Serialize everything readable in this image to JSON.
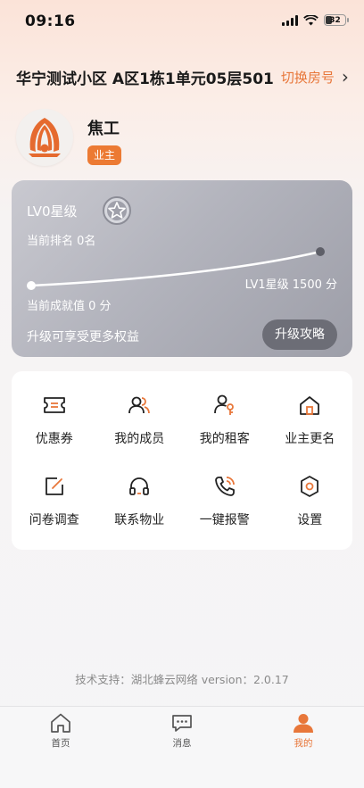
{
  "status_bar": {
    "time": "09:16",
    "battery": "32"
  },
  "header": {
    "address": "华宁测试小区 A区1栋1单元05层501",
    "switch_label": "切换房号"
  },
  "user": {
    "name": "焦工",
    "role": "业主"
  },
  "level_card": {
    "level": "LV0星级",
    "rank": "当前排名 0名",
    "next_level": "LV1星级 1500 分",
    "score": "当前成就值 0 分",
    "tip": "升级可享受更多权益",
    "button": "升级攻略",
    "progress": 0
  },
  "menu": [
    {
      "label": "优惠券",
      "icon": "coupon-icon"
    },
    {
      "label": "我的成员",
      "icon": "members-icon"
    },
    {
      "label": "我的租客",
      "icon": "tenant-key-icon"
    },
    {
      "label": "业主更名",
      "icon": "home-icon"
    },
    {
      "label": "问卷调查",
      "icon": "survey-edit-icon"
    },
    {
      "label": "联系物业",
      "icon": "headset-icon"
    },
    {
      "label": "一键报警",
      "icon": "phone-alarm-icon"
    },
    {
      "label": "设置",
      "icon": "settings-hexagon-icon"
    }
  ],
  "footer": {
    "support": "技术支持：湖北蜂云网络 version：2.0.17"
  },
  "tabs": [
    {
      "label": "首页",
      "icon": "home-icon",
      "active": false
    },
    {
      "label": "消息",
      "icon": "message-icon",
      "active": false
    },
    {
      "label": "我的",
      "icon": "user-icon",
      "active": true
    }
  ],
  "colors": {
    "accent": "#e8773a",
    "card_gray": "#b3b4bd"
  }
}
